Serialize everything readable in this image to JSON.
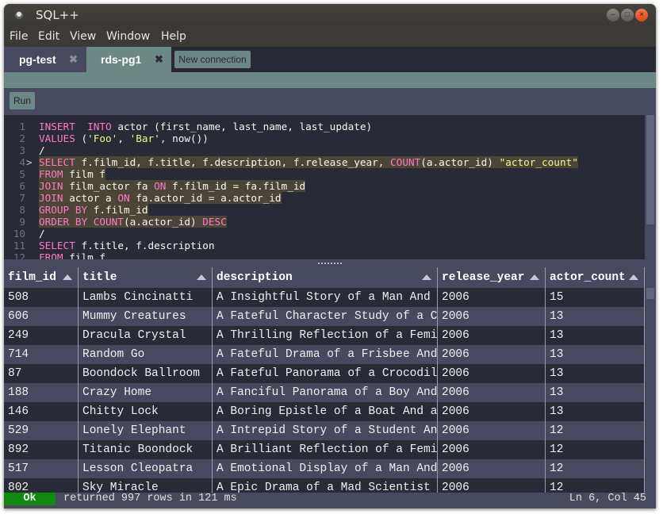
{
  "window": {
    "title": "SQL++",
    "controls": {
      "minimize": "–",
      "maximize": "□",
      "close": "×"
    }
  },
  "menu": [
    "File",
    "Edit",
    "View",
    "Window",
    "Help"
  ],
  "tabs": [
    {
      "label": "pg-test",
      "active": false,
      "close": "✖"
    },
    {
      "label": "rds-pg1",
      "active": true,
      "close": "✖"
    }
  ],
  "new_connection_label": "New connection",
  "toolbar": {
    "run_label": "Run"
  },
  "editor": {
    "current_line": 4,
    "current_line_marker": ">",
    "lines": [
      {
        "n": "1",
        "tokens": [
          [
            "kw",
            "INSERT"
          ],
          [
            "",
            "  "
          ],
          [
            "kw",
            "INTO"
          ],
          [
            "",
            " actor (first_name, last_name, last_update)"
          ]
        ]
      },
      {
        "n": "2",
        "tokens": [
          [
            "kw",
            "VALUES"
          ],
          [
            "",
            " ("
          ],
          [
            "str",
            "'Foo'"
          ],
          [
            "",
            ", "
          ],
          [
            "str",
            "'Bar'"
          ],
          [
            "",
            ", now())"
          ]
        ]
      },
      {
        "n": "3",
        "tokens": [
          [
            "",
            "/"
          ]
        ]
      },
      {
        "n": "4",
        "hl": true,
        "tokens": [
          [
            "kw",
            "SELECT"
          ],
          [
            "",
            " f.film_id, f.title, f.description, f.release_year, "
          ],
          [
            "kw",
            "COUNT"
          ],
          [
            "",
            "(a.actor_id) "
          ],
          [
            "str",
            "\"actor_count\""
          ]
        ]
      },
      {
        "n": "5",
        "hl": true,
        "tokens": [
          [
            "kw",
            "FROM"
          ],
          [
            "",
            " film f"
          ]
        ]
      },
      {
        "n": "6",
        "hl": true,
        "tokens": [
          [
            "kw",
            "JOIN"
          ],
          [
            "",
            " film_actor fa "
          ],
          [
            "kw",
            "ON"
          ],
          [
            "",
            " f.film_id = fa.film_id"
          ]
        ]
      },
      {
        "n": "7",
        "hl": true,
        "tokens": [
          [
            "kw",
            "JOIN"
          ],
          [
            "",
            " actor a "
          ],
          [
            "kw",
            "ON"
          ],
          [
            "",
            " fa.actor_id = a.actor_id"
          ]
        ]
      },
      {
        "n": "8",
        "hl": true,
        "tokens": [
          [
            "kw",
            "GROUP BY"
          ],
          [
            "",
            " f.film_id"
          ]
        ]
      },
      {
        "n": "9",
        "hl": true,
        "tokens": [
          [
            "kw",
            "ORDER BY"
          ],
          [
            "",
            " "
          ],
          [
            "kw",
            "COUNT"
          ],
          [
            "",
            "(a.actor_id) "
          ],
          [
            "kw",
            "DESC"
          ]
        ]
      },
      {
        "n": "10",
        "tokens": [
          [
            "",
            "/"
          ]
        ]
      },
      {
        "n": "11",
        "tokens": [
          [
            "kw",
            "SELECT"
          ],
          [
            "",
            " f.title, f.description"
          ]
        ]
      },
      {
        "n": "12",
        "tokens": [
          [
            "kw",
            "FROM"
          ],
          [
            "",
            " film f"
          ]
        ]
      }
    ]
  },
  "results": {
    "columns": [
      "film_id",
      "title",
      "description",
      "release_year",
      "actor_count"
    ],
    "rows": [
      [
        "508",
        "Lambs Cincinatti",
        "A Insightful Story of a Man And …",
        "2006",
        "15"
      ],
      [
        "606",
        "Mummy Creatures",
        "A Fateful Character Study of a C…",
        "2006",
        "13"
      ],
      [
        "249",
        "Dracula Crystal",
        "A Thrilling Reflection of a Femi…",
        "2006",
        "13"
      ],
      [
        "714",
        "Random Go",
        "A Fateful Drama of a Frisbee And…",
        "2006",
        "13"
      ],
      [
        "87",
        "Boondock Ballroom",
        "A Fateful Panorama of a Crocodil…",
        "2006",
        "13"
      ],
      [
        "188",
        "Crazy Home",
        "A Fanciful Panorama of a Boy And…",
        "2006",
        "13"
      ],
      [
        "146",
        "Chitty Lock",
        "A Boring Epistle of a Boat And a…",
        "2006",
        "13"
      ],
      [
        "529",
        "Lonely Elephant",
        "A Intrepid Story of a Student An…",
        "2006",
        "12"
      ],
      [
        "892",
        "Titanic Boondock",
        "A Brilliant Reflection of a Femi…",
        "2006",
        "12"
      ],
      [
        "517",
        "Lesson Cleopatra",
        "A Emotional Display of a Man And…",
        "2006",
        "12"
      ],
      [
        "802",
        "Sky Miracle",
        "A Epic Drama of a Mad Scientist …",
        "2006",
        "12"
      ]
    ]
  },
  "status": {
    "state": "Ok",
    "message": "returned 997 rows in 121 ms",
    "cursor": "Ln 6, Col 45"
  },
  "colors": {
    "status_ok": "#0f8a0f",
    "accent": "#6b8884",
    "keyword": "#ff79c6",
    "string": "#f1fa8c",
    "editor_bg": "#282a36"
  }
}
